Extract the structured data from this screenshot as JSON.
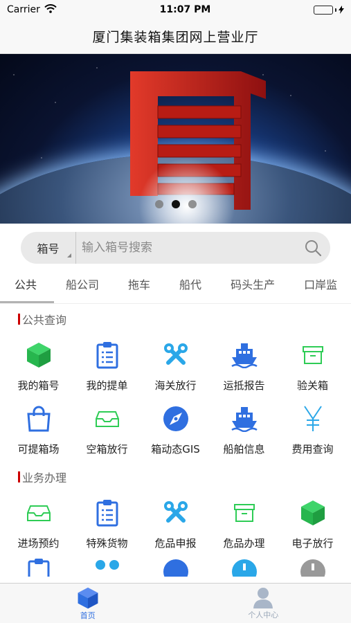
{
  "status_bar": {
    "carrier": "Carrier",
    "time": "11:07 PM"
  },
  "nav": {
    "title": "厦门集装箱集团网上营业厅"
  },
  "banner": {
    "slides": 3,
    "active_slide": 1
  },
  "search": {
    "type_label": "箱号",
    "placeholder": "输入箱号搜索"
  },
  "tabs": [
    "公共",
    "船公司",
    "拖车",
    "船代",
    "码头生产",
    "口岸监"
  ],
  "sections": {
    "public": {
      "title": "公共查询",
      "items": [
        {
          "label": "我的箱号",
          "icon": "cube-icon"
        },
        {
          "label": "我的提单",
          "icon": "clipboard-icon"
        },
        {
          "label": "海关放行",
          "icon": "tools-icon"
        },
        {
          "label": "运抵报告",
          "icon": "ship-icon"
        },
        {
          "label": "验关箱",
          "icon": "archive-box-icon"
        },
        {
          "label": "可提箱场",
          "icon": "shopping-bag-icon"
        },
        {
          "label": "空箱放行",
          "icon": "inbox-icon"
        },
        {
          "label": "箱动态GIS",
          "icon": "compass-icon"
        },
        {
          "label": "船舶信息",
          "icon": "ship-icon"
        },
        {
          "label": "费用查询",
          "icon": "yen-icon"
        }
      ]
    },
    "business": {
      "title": "业务办理",
      "items": [
        {
          "label": "进场预约",
          "icon": "inbox-icon"
        },
        {
          "label": "特殊货物",
          "icon": "clipboard-icon"
        },
        {
          "label": "危品申报",
          "icon": "tools-icon"
        },
        {
          "label": "危品办理",
          "icon": "archive-box-icon"
        },
        {
          "label": "电子放行",
          "icon": "cube-icon"
        }
      ]
    }
  },
  "tabbar": {
    "home": "首页",
    "profile": "个人中心"
  },
  "colors": {
    "blue": "#2f6fe0",
    "green": "#2ecc55",
    "cyan": "#2aa7e8",
    "red": "#c00000"
  }
}
